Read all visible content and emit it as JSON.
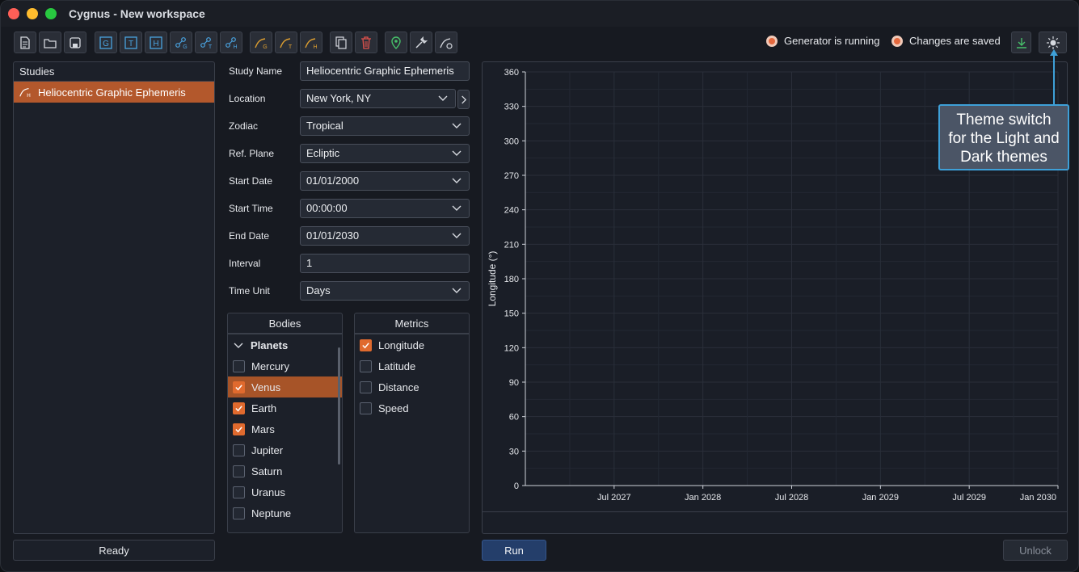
{
  "window": {
    "title": "Cygnus - New workspace"
  },
  "toolbar": {
    "buttons": [
      "new-file-icon",
      "open-folder-icon",
      "save-icon",
      "graphic-ephemeris-icon",
      "text-ephemeris-icon",
      "heliocentric-ephemeris-icon",
      "new-geocentric-chart-icon",
      "new-topocentric-chart-icon",
      "new-heliocentric-chart-icon",
      "new-geo-orange-icon",
      "new-topo-orange-icon",
      "new-helio-orange-icon",
      "duplicate-icon",
      "delete-icon",
      "location-icon",
      "settings-wrench-icon",
      "chart-settings-icon"
    ]
  },
  "status": {
    "generator": "Generator is running",
    "saved": "Changes are saved"
  },
  "colors": {
    "accent": "#e06a2e",
    "selection": "#b3582c",
    "tooltip_border": "#3ea0d8"
  },
  "studies": {
    "header": "Studies",
    "items": [
      "Heliocentric Graphic Ephemeris"
    ],
    "status_label": "Ready"
  },
  "form": {
    "study_name": {
      "label": "Study Name",
      "value": "Heliocentric Graphic Ephemeris"
    },
    "location": {
      "label": "Location",
      "value": "New York, NY"
    },
    "zodiac": {
      "label": "Zodiac",
      "value": "Tropical"
    },
    "ref_plane": {
      "label": "Ref. Plane",
      "value": "Ecliptic"
    },
    "start_date": {
      "label": "Start Date",
      "value": "01/01/2000"
    },
    "start_time": {
      "label": "Start Time",
      "value": "00:00:00"
    },
    "end_date": {
      "label": "End Date",
      "value": "01/01/2030"
    },
    "interval": {
      "label": "Interval",
      "value": "1"
    },
    "time_unit": {
      "label": "Time Unit",
      "value": "Days"
    }
  },
  "bodies": {
    "header": "Bodies",
    "group": "Planets",
    "items": [
      {
        "label": "Mercury",
        "checked": false
      },
      {
        "label": "Venus",
        "checked": true
      },
      {
        "label": "Earth",
        "checked": true
      },
      {
        "label": "Mars",
        "checked": true
      },
      {
        "label": "Jupiter",
        "checked": false
      },
      {
        "label": "Saturn",
        "checked": false
      },
      {
        "label": "Uranus",
        "checked": false
      },
      {
        "label": "Neptune",
        "checked": false
      }
    ]
  },
  "metrics": {
    "header": "Metrics",
    "items": [
      {
        "label": "Longitude",
        "checked": true
      },
      {
        "label": "Latitude",
        "checked": false
      },
      {
        "label": "Distance",
        "checked": false
      },
      {
        "label": "Speed",
        "checked": false
      }
    ]
  },
  "chart_data": {
    "type": "line",
    "ylabel": "Longitude (°)",
    "xlabel": "",
    "ylim": [
      0,
      360
    ],
    "yticks": [
      0,
      30,
      60,
      90,
      120,
      150,
      180,
      210,
      240,
      270,
      300,
      330,
      360
    ],
    "xticks": [
      "Jul 2027",
      "Jan 2028",
      "Jul 2028",
      "Jan 2029",
      "Jul 2029",
      "Jan 2030"
    ],
    "series": [],
    "grid": true
  },
  "actions": {
    "run": "Run",
    "unlock": "Unlock"
  },
  "tooltip": {
    "lines": [
      "Theme switch",
      "for the Light and",
      "Dark themes"
    ]
  }
}
